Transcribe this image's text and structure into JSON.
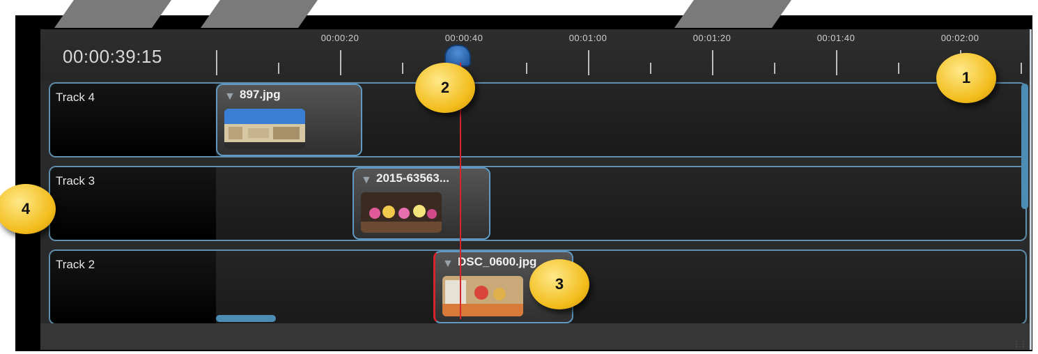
{
  "timeline": {
    "timecode": "00:00:39:15",
    "ruler_labels": [
      "00:00:20",
      "00:00:40",
      "00:01:00",
      "00:01:20",
      "00:01:40",
      "00:02:00"
    ]
  },
  "tracks": [
    {
      "name": "Track 4",
      "clip": {
        "title": "897.jpg"
      }
    },
    {
      "name": "Track 3",
      "clip": {
        "title": "2015-63563..."
      }
    },
    {
      "name": "Track 2",
      "clip": {
        "title": "DSC_0600.jpg"
      }
    }
  ],
  "callouts": [
    "1",
    "2",
    "3",
    "4"
  ],
  "colors": {
    "accent_blue": "#5f9ac2",
    "playhead_red": "#d6252b",
    "callout_yellow": "#f2bc1b"
  }
}
